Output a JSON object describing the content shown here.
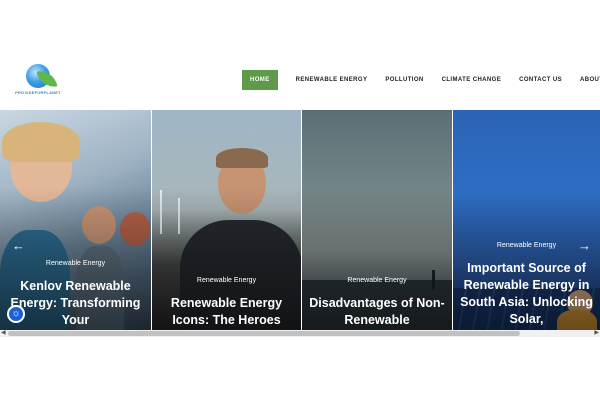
{
  "logo": {
    "text": "PROVIDEFORPLANET",
    "icon": "globe-leaf-icon"
  },
  "nav": {
    "items": [
      {
        "label": "HOME",
        "active": true
      },
      {
        "label": "RENEWABLE ENERGY",
        "active": false
      },
      {
        "label": "POLLUTION",
        "active": false
      },
      {
        "label": "CLIMATE CHANGE",
        "active": false
      },
      {
        "label": "CONTACT US",
        "active": false
      },
      {
        "label": "ABOUT US",
        "active": false
      }
    ]
  },
  "slides": [
    {
      "category": "Renewable Energy",
      "title": "Kenlov Renewable Energy: Transforming Your"
    },
    {
      "category": "Renewable Energy",
      "title": "Renewable Energy Icons: The Heroes"
    },
    {
      "category": "Renewable Energy",
      "title": "Disadvantages of Non-Renewable"
    },
    {
      "category": "Renewable Energy",
      "title": "Important Source of Renewable Energy in South Asia: Unlocking Solar,"
    }
  ],
  "colors": {
    "accent": "#5e9a47",
    "a11y": "#1d5fd6"
  },
  "icons": {
    "prev": "arrow-left-icon",
    "next": "arrow-right-icon",
    "accessibility": "accessibility-icon"
  }
}
